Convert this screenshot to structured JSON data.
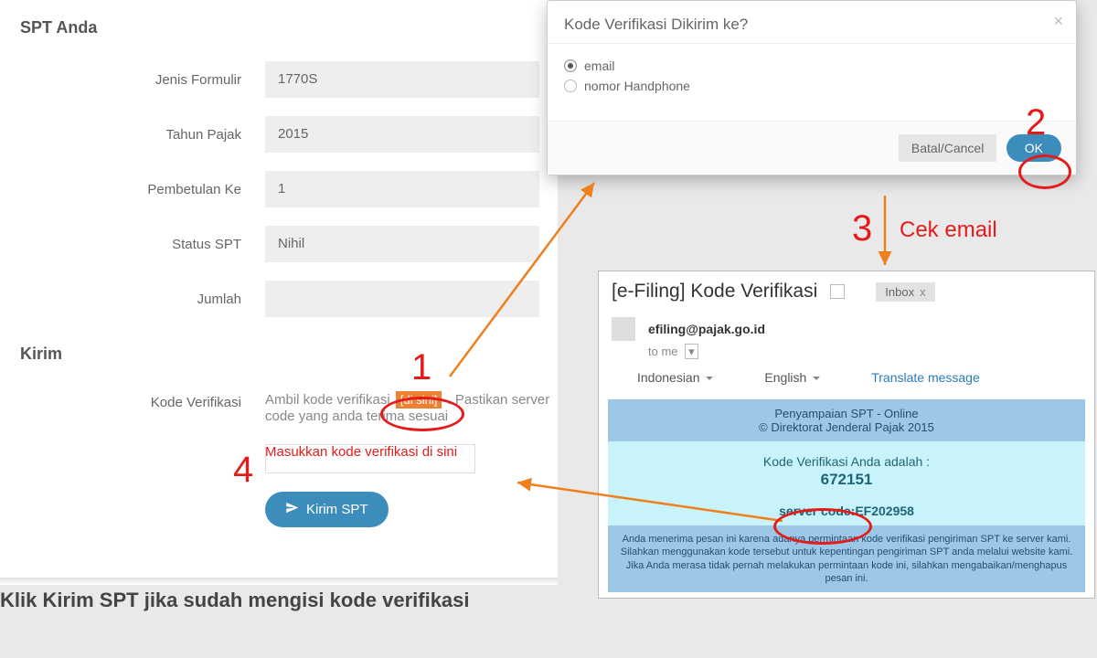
{
  "form": {
    "section_title": "SPT Anda",
    "section2_title": "Kirim",
    "labels": {
      "jenis": "Jenis Formulir",
      "tahun": "Tahun Pajak",
      "pembetulan": "Pembetulan Ke",
      "status": "Status SPT",
      "jumlah": "Jumlah",
      "kode": "Kode Verifikasi"
    },
    "values": {
      "jenis": "1770S",
      "tahun": "2015",
      "pembetulan": "1",
      "status": "Nihil",
      "jumlah": ""
    },
    "verif_text_1": "Ambil kode verifikasi",
    "verif_disini": "[di sini]",
    "verif_text_2": ". Pastikan server code yang anda terima sesuai",
    "verif_placeholder": "Masukkan kode verifikasi di sini",
    "kirim_btn": "Kirim SPT"
  },
  "caption": "Klik Kirim SPT jika sudah mengisi kode verifikasi",
  "modal": {
    "title": "Kode Verifikasi Dikirim ke?",
    "opt_email": "email",
    "opt_hp": "nomor Handphone",
    "cancel": "Batal/Cancel",
    "ok": "OK"
  },
  "email": {
    "subject": "[e-Filing] Kode Verifikasi",
    "inbox_chip": "Inbox",
    "sender": "efiling@pajak.go.id",
    "to": "to me",
    "lang1": "Indonesian",
    "lang2": "English",
    "translate": "Translate message",
    "hdr_line1": "Penyampaian SPT - Online",
    "hdr_line2": "© Direktorat Jenderal Pajak 2015",
    "verif_line": "Kode Verifikasi Anda adalah :",
    "verif_code": "672151",
    "server_code_line": "server code:EF202958",
    "disclaimer": "Anda menerima pesan ini karena adanya permintaan kode verifikasi pengiriman SPT ke server kami. Silahkan menggunakan kode tersebut untuk kepentingan pengiriman SPT anda melalui website kami. Jika Anda merasa tidak pernah melakukan permintaan kode ini, silahkan mengabaikan/menghapus pesan ini."
  },
  "anno": {
    "n1": "1",
    "n2": "2",
    "n3": "3",
    "n4": "4",
    "cek_email": "Cek email"
  }
}
